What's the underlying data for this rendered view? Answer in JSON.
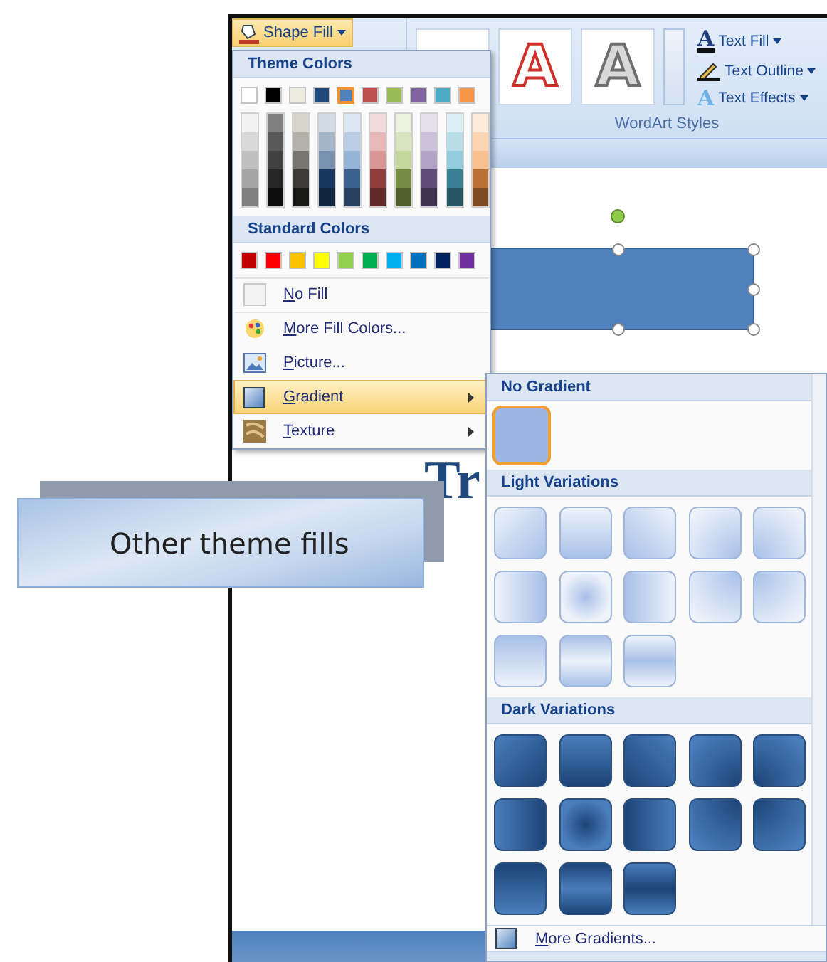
{
  "ribbon": {
    "shape_fill": {
      "label": "Shape Fill"
    },
    "wordart_gallery": [
      {
        "kind": "hidden"
      },
      {
        "kind": "red-outline",
        "glyph": "A"
      },
      {
        "kind": "white-outline",
        "glyph": "A"
      }
    ],
    "text_commands": [
      {
        "label": "Text Fill",
        "kind": "fill",
        "glyph": "A"
      },
      {
        "label": "Text Outline",
        "kind": "outline"
      },
      {
        "label": "Text Effects",
        "kind": "effects",
        "glyph": "A"
      }
    ],
    "group_label": "WordArt Styles"
  },
  "slide": {
    "title_fragment": "Tr",
    "shape_selected": true
  },
  "shape_fill_menu": {
    "theme_header": "Theme Colors",
    "theme_colors": [
      {
        "color": "#ffffff",
        "selected": false
      },
      {
        "color": "#000000",
        "selected": false
      },
      {
        "color": "#eeece1",
        "selected": false
      },
      {
        "color": "#1f497d",
        "selected": false
      },
      {
        "color": "#4f81bd",
        "selected": true
      },
      {
        "color": "#c0504d",
        "selected": false
      },
      {
        "color": "#9bbb59",
        "selected": false
      },
      {
        "color": "#8064a2",
        "selected": false
      },
      {
        "color": "#4bacc6",
        "selected": false
      },
      {
        "color": "#f79646",
        "selected": false
      }
    ],
    "standard_header": "Standard Colors",
    "standard_colors": [
      {
        "color": "#c00000"
      },
      {
        "color": "#ff0000"
      },
      {
        "color": "#ffc000"
      },
      {
        "color": "#ffff00"
      },
      {
        "color": "#92d050"
      },
      {
        "color": "#00b050"
      },
      {
        "color": "#00b0f0"
      },
      {
        "color": "#0070c0"
      },
      {
        "color": "#002060"
      },
      {
        "color": "#7030a0"
      }
    ],
    "items": [
      {
        "label": "No Fill",
        "kind": "none",
        "selected": false,
        "submenu": false
      },
      {
        "label": "More Fill Colors...",
        "kind": "palette",
        "selected": false,
        "submenu": false
      },
      {
        "label": "Picture...",
        "kind": "picture",
        "selected": false,
        "submenu": false
      },
      {
        "label": "Gradient",
        "kind": "gradient",
        "selected": true,
        "submenu": true
      },
      {
        "label": "Texture",
        "kind": "texture",
        "selected": false,
        "submenu": true
      }
    ]
  },
  "gradient_menu": {
    "sections": [
      {
        "title": "No Gradient",
        "kind": "none",
        "tiles": [
          {
            "kind": "flat",
            "selected": true
          }
        ]
      },
      {
        "title": "Light Variations",
        "kind": "light",
        "tiles": [
          {
            "kind": "diag-down",
            "selected": false
          },
          {
            "kind": "down",
            "selected": false
          },
          {
            "kind": "diag-up",
            "selected": false
          },
          {
            "kind": "corner-br",
            "selected": false
          },
          {
            "kind": "corner-bl",
            "selected": false
          },
          {
            "kind": "right",
            "selected": false
          },
          {
            "kind": "center",
            "selected": false
          },
          {
            "kind": "left",
            "selected": false
          },
          {
            "kind": "corner-tr",
            "selected": false
          },
          {
            "kind": "corner-tl",
            "selected": false
          },
          {
            "kind": "up",
            "selected": false
          },
          {
            "kind": "middle",
            "selected": false
          },
          {
            "kind": "edges",
            "selected": false
          }
        ]
      },
      {
        "title": "Dark Variations",
        "kind": "dark",
        "tiles": [
          {
            "kind": "diag-down",
            "selected": false
          },
          {
            "kind": "down",
            "selected": false
          },
          {
            "kind": "diag-up",
            "selected": false
          },
          {
            "kind": "corner-br",
            "selected": false
          },
          {
            "kind": "corner-bl",
            "selected": false
          },
          {
            "kind": "right",
            "selected": false
          },
          {
            "kind": "center",
            "selected": false
          },
          {
            "kind": "left",
            "selected": false
          },
          {
            "kind": "corner-tr",
            "selected": false
          },
          {
            "kind": "corner-tl",
            "selected": false
          },
          {
            "kind": "up",
            "selected": false
          },
          {
            "kind": "middle",
            "selected": false
          },
          {
            "kind": "edges",
            "selected": false
          }
        ]
      }
    ],
    "more_item": "More Gradients..."
  },
  "callout": "Other theme fills"
}
